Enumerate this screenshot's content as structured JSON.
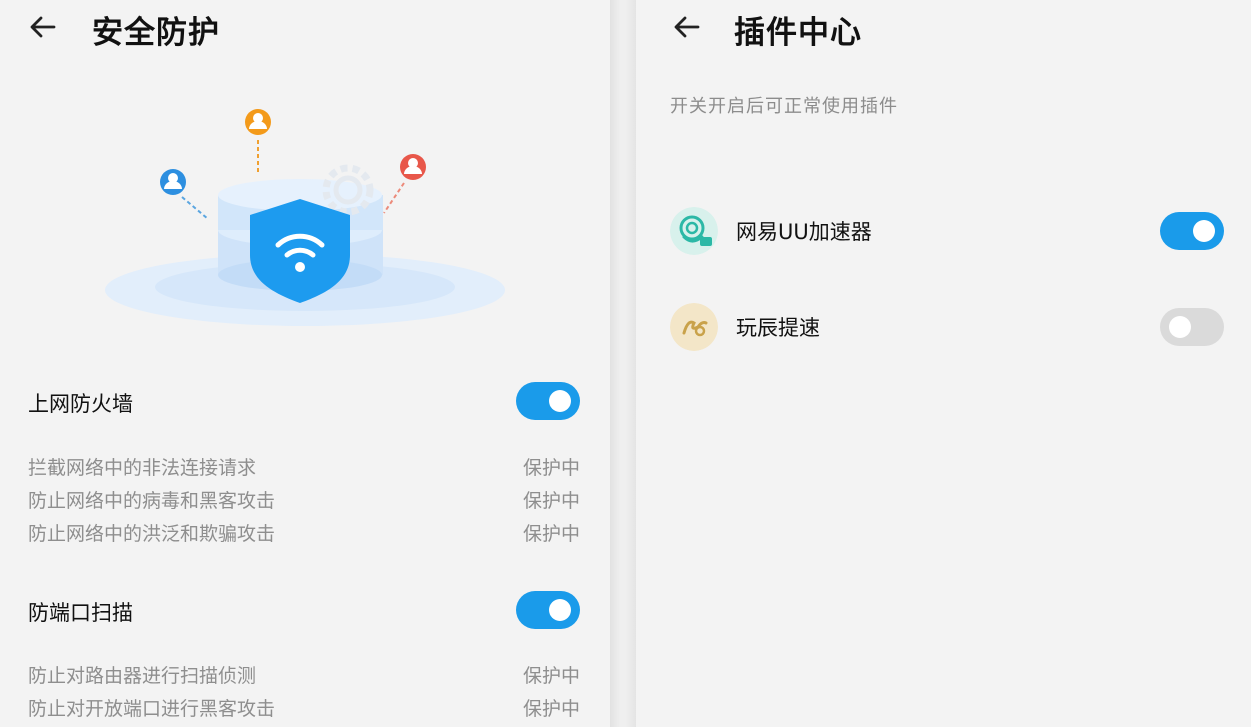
{
  "left": {
    "title": "安全防护",
    "firewall": {
      "title": "上网防火墙",
      "enabled": true,
      "items": [
        {
          "desc": "拦截网络中的非法连接请求",
          "status": "保护中"
        },
        {
          "desc": "防止网络中的病毒和黑客攻击",
          "status": "保护中"
        },
        {
          "desc": "防止网络中的洪泛和欺骗攻击",
          "status": "保护中"
        }
      ]
    },
    "portscan": {
      "title": "防端口扫描",
      "enabled": true,
      "items": [
        {
          "desc": "防止对路由器进行扫描侦测",
          "status": "保护中"
        },
        {
          "desc": "防止对开放端口进行黑客攻击",
          "status": "保护中"
        }
      ]
    }
  },
  "right": {
    "title": "插件中心",
    "subtitle": "开关开启后可正常使用插件",
    "plugins": [
      {
        "name": "网易UU加速器",
        "enabled": true,
        "icon": "uu-accelerator-icon"
      },
      {
        "name": "玩辰提速",
        "enabled": false,
        "icon": "wanchen-icon"
      }
    ]
  },
  "colors": {
    "accent": "#1a9bea",
    "toggle_off": "#dadada",
    "shield": "#1d9bef"
  }
}
